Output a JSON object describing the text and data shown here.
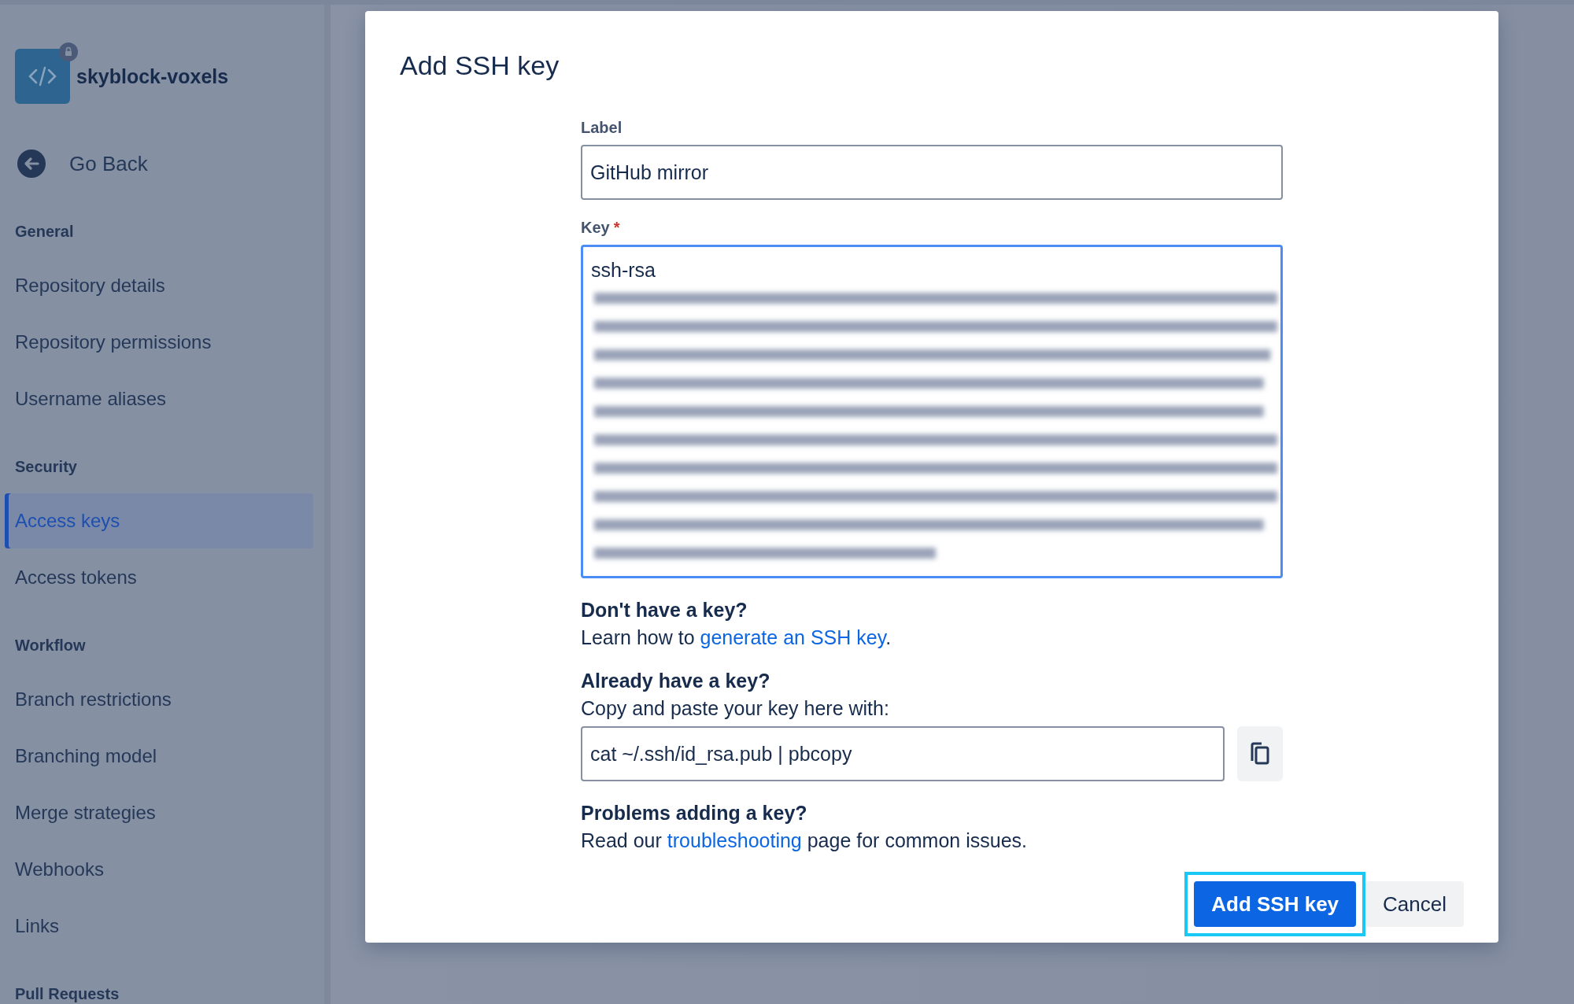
{
  "sidebar": {
    "repo": {
      "name": "skyblock-voxels",
      "private": true
    },
    "back": "Go Back",
    "sections": [
      {
        "heading": "General",
        "items": [
          {
            "label": "Repository details",
            "selected": false
          },
          {
            "label": "Repository permissions",
            "selected": false
          },
          {
            "label": "Username aliases",
            "selected": false
          }
        ]
      },
      {
        "heading": "Security",
        "items": [
          {
            "label": "Access keys",
            "selected": true
          },
          {
            "label": "Access tokens",
            "selected": false
          }
        ]
      },
      {
        "heading": "Workflow",
        "items": [
          {
            "label": "Branch restrictions",
            "selected": false
          },
          {
            "label": "Branching model",
            "selected": false
          },
          {
            "label": "Merge strategies",
            "selected": false
          },
          {
            "label": "Webhooks",
            "selected": false
          },
          {
            "label": "Links",
            "selected": false
          }
        ]
      },
      {
        "heading": "Pull Requests"
      }
    ]
  },
  "dialog": {
    "title": "Add SSH key",
    "label_field": {
      "label": "Label",
      "value": "GitHub mirror"
    },
    "key_field": {
      "label": "Key",
      "required_mark": "*",
      "value": "ssh-rsa"
    },
    "help": [
      {
        "heading": "Don't have a key?",
        "before": "Learn how to ",
        "link": "generate an SSH key",
        "after": "."
      },
      {
        "heading": "Already have a key?",
        "text": "Copy and paste your key here with:",
        "command": "cat ~/.ssh/id_rsa.pub | pbcopy"
      },
      {
        "heading": "Problems adding a key?",
        "before": "Read our ",
        "link": "troubleshooting",
        "after": " page for common issues."
      }
    ],
    "buttons": [
      {
        "label": "Add SSH key",
        "kind": "primary",
        "focused": true
      },
      {
        "label": "Cancel",
        "kind": "subtle",
        "focused": false
      }
    ]
  }
}
